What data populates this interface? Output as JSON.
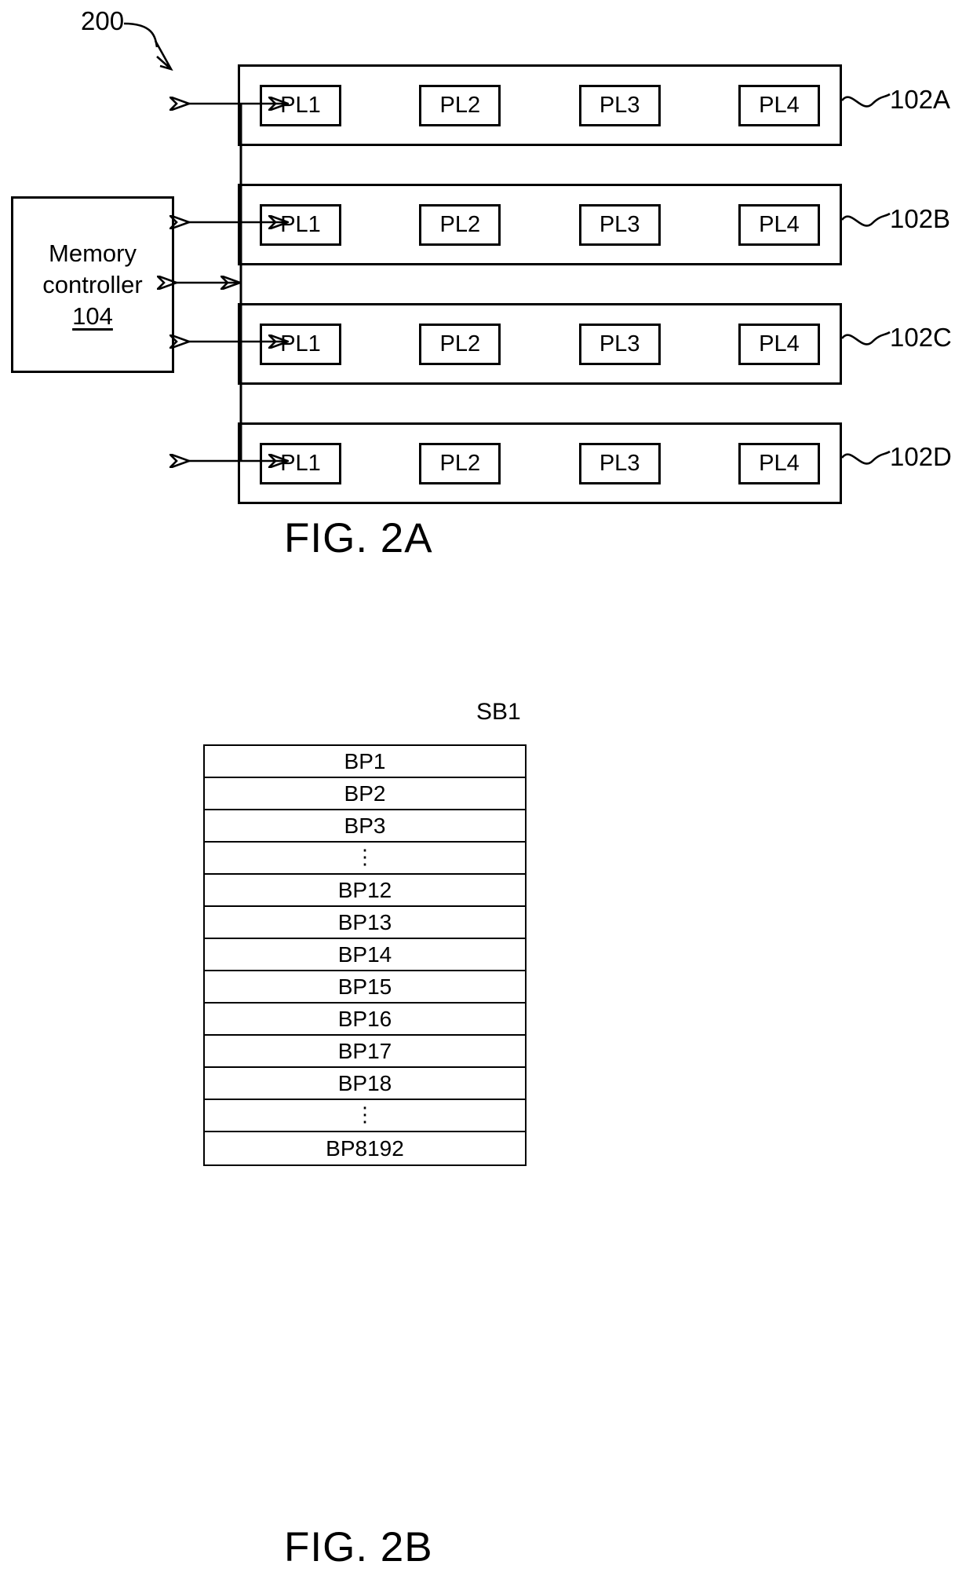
{
  "figure_2a": {
    "system_ref": "200",
    "controller": {
      "line1": "Memory",
      "line2": "controller",
      "ref": "104"
    },
    "dies": [
      {
        "ref": "102A",
        "planes": [
          "PL1",
          "PL2",
          "PL3",
          "PL4"
        ]
      },
      {
        "ref": "102B",
        "planes": [
          "PL1",
          "PL2",
          "PL3",
          "PL4"
        ]
      },
      {
        "ref": "102C",
        "planes": [
          "PL1",
          "PL2",
          "PL3",
          "PL4"
        ]
      },
      {
        "ref": "102D",
        "planes": [
          "PL1",
          "PL2",
          "PL3",
          "PL4"
        ]
      }
    ],
    "caption": "FIG. 2A"
  },
  "figure_2b": {
    "superblock_label": "SB1",
    "rows": [
      "BP1",
      "BP2",
      "BP3",
      "⋮",
      "BP12",
      "BP13",
      "BP14",
      "BP15",
      "BP16",
      "BP17",
      "BP18",
      "⋮",
      "BP8192"
    ],
    "caption": "FIG. 2B"
  },
  "colors": {
    "stroke": "#000000",
    "background": "#ffffff"
  }
}
